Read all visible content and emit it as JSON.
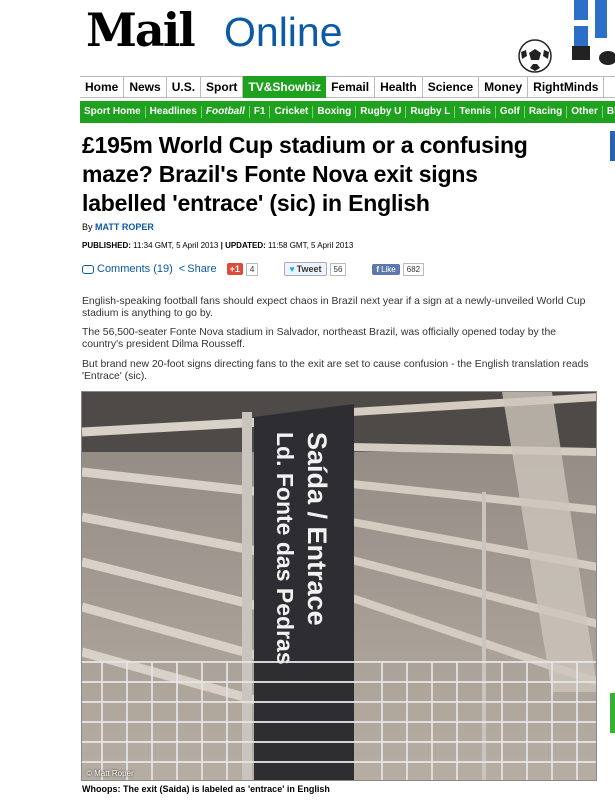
{
  "masthead": {
    "logo_mail": "Mail",
    "logo_online": "Online"
  },
  "nav_primary": [
    {
      "label": "Home",
      "active": false
    },
    {
      "label": "News",
      "active": false
    },
    {
      "label": "U.S.",
      "active": false
    },
    {
      "label": "Sport",
      "active": false
    },
    {
      "label": "TV&Showbiz",
      "active": true
    },
    {
      "label": "Femail",
      "active": false
    },
    {
      "label": "Health",
      "active": false
    },
    {
      "label": "Science",
      "active": false
    },
    {
      "label": "Money",
      "active": false
    },
    {
      "label": "RightMinds",
      "active": false
    }
  ],
  "nav_secondary": [
    {
      "label": "Sport Home",
      "italic": false
    },
    {
      "label": "Headlines",
      "italic": false
    },
    {
      "label": "Football",
      "italic": true
    },
    {
      "label": "F1",
      "italic": false
    },
    {
      "label": "Cricket",
      "italic": false
    },
    {
      "label": "Boxing",
      "italic": false
    },
    {
      "label": "Rugby U",
      "italic": false
    },
    {
      "label": "Rugby L",
      "italic": false
    },
    {
      "label": "Tennis",
      "italic": false
    },
    {
      "label": "Golf",
      "italic": false
    },
    {
      "label": "Racing",
      "italic": false
    },
    {
      "label": "Other",
      "italic": false
    },
    {
      "label": "Blo",
      "italic": false
    }
  ],
  "article": {
    "headline": "£195m World Cup stadium or a confusing maze? Brazil's Fonte Nova exit signs labelled 'entrace' (sic) in English",
    "byline_prefix": "By",
    "author": "MATT ROPER",
    "published_label": "PUBLISHED:",
    "published": "11:34 GMT, 5 April 2013",
    "updated_label": "UPDATED:",
    "updated": "11:58 GMT, 5 April 2013",
    "paragraphs": [
      "English-speaking football fans should expect chaos in Brazil next year if a sign at a newly-unveiled World Cup stadium is anything to go by.",
      "The 56,500-seater Fonte Nova stadium in Salvador, northeast Brazil, was officially opened today by the country's president Dilma Rousseff.",
      "But brand new 20-foot signs directing fans to the exit are set to cause confusion - the English translation reads 'Entrace' (sic)."
    ],
    "photo": {
      "sign_line1": "Saída / Entrace",
      "sign_line2": "Ld. Fonte das Pedras",
      "credit": "© Matt Roper",
      "caption": "Whoops: The exit (Saida) is labeled as 'entrace' in English"
    }
  },
  "share": {
    "comments": "Comments (19)",
    "share_label": "Share",
    "gplus_label": "+1",
    "gplus_count": "4",
    "tweet_label": "Tweet",
    "tweet_count": "56",
    "like_label": "Like",
    "like_count": "682"
  },
  "colors": {
    "brand_blue": "#0c5aa6",
    "sport_green": "#1ea21e"
  }
}
